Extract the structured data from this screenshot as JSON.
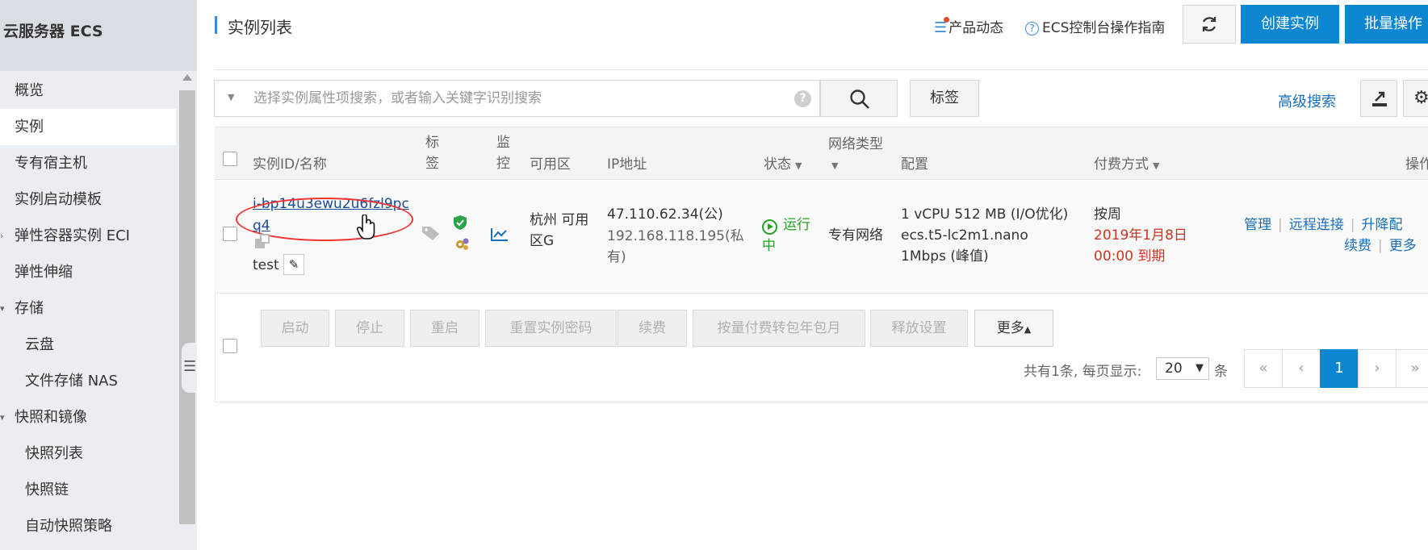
{
  "sidebar": {
    "title": "云服务器 ECS",
    "items": [
      {
        "label": "概览"
      },
      {
        "label": "实例"
      },
      {
        "label": "专有宿主机"
      },
      {
        "label": "实例启动模板"
      },
      {
        "label": "弹性容器实例 ECI"
      },
      {
        "label": "弹性伸缩"
      },
      {
        "label": "存储"
      },
      {
        "label": "云盘"
      },
      {
        "label": "文件存储 NAS"
      },
      {
        "label": "快照和镜像"
      },
      {
        "label": "快照列表"
      },
      {
        "label": "快照链"
      },
      {
        "label": "自动快照策略"
      }
    ]
  },
  "header": {
    "title": "实例列表",
    "news_label": "产品动态",
    "guide_label": "ECS控制台操作指南",
    "create_label": "创建实例",
    "batch_label": "批量操作"
  },
  "search": {
    "placeholder": "选择实例属性项搜索，或者输入关键字识别搜索",
    "help": "?",
    "tag_label": "标签",
    "advanced_label": "高级搜索"
  },
  "table": {
    "columns": {
      "id_name": "实例ID/名称",
      "tag": "标签",
      "monitor": "监控",
      "zone": "可用区",
      "ip": "IP地址",
      "status": "状态",
      "network": "网络类型",
      "config": "配置",
      "billing": "付费方式",
      "ops": "操作"
    },
    "rows": [
      {
        "id": "i-bp14u3ewu2u6fzl9pcq4",
        "name": "test",
        "zone": "杭州 可用区G",
        "ip_public": "47.110.62.34(公)",
        "ip_private": "192.168.118.195(私有)",
        "status": "运行中",
        "network": "专有网络",
        "config_line1": "1 vCPU 512 MB (I/O优化)",
        "config_line2": "ecs.t5-lc2m1.nano",
        "config_line3": "1Mbps (峰值)",
        "billing": "按周",
        "expire": "2019年1月8日 00:00 到期",
        "ops": {
          "manage": "管理",
          "remote": "远程连接",
          "upgrade": "升降配",
          "renew": "续费",
          "more": "更多"
        }
      }
    ]
  },
  "actions": {
    "start": "启动",
    "stop": "停止",
    "restart": "重启",
    "reset_password": "重置实例密码",
    "renew": "续费",
    "convert_billing": "按量付费转包年包月",
    "release": "释放设置",
    "more": "更多"
  },
  "pagination": {
    "summary": "共有1条, 每页显示:",
    "page_size": "20",
    "unit": "条",
    "first": "«",
    "prev": "‹",
    "current": "1",
    "next": "›",
    "last": "»"
  },
  "colors": {
    "primary": "#0a87d0",
    "link": "#1a6fb8",
    "running": "#26a326",
    "expire": "#d0341e"
  }
}
